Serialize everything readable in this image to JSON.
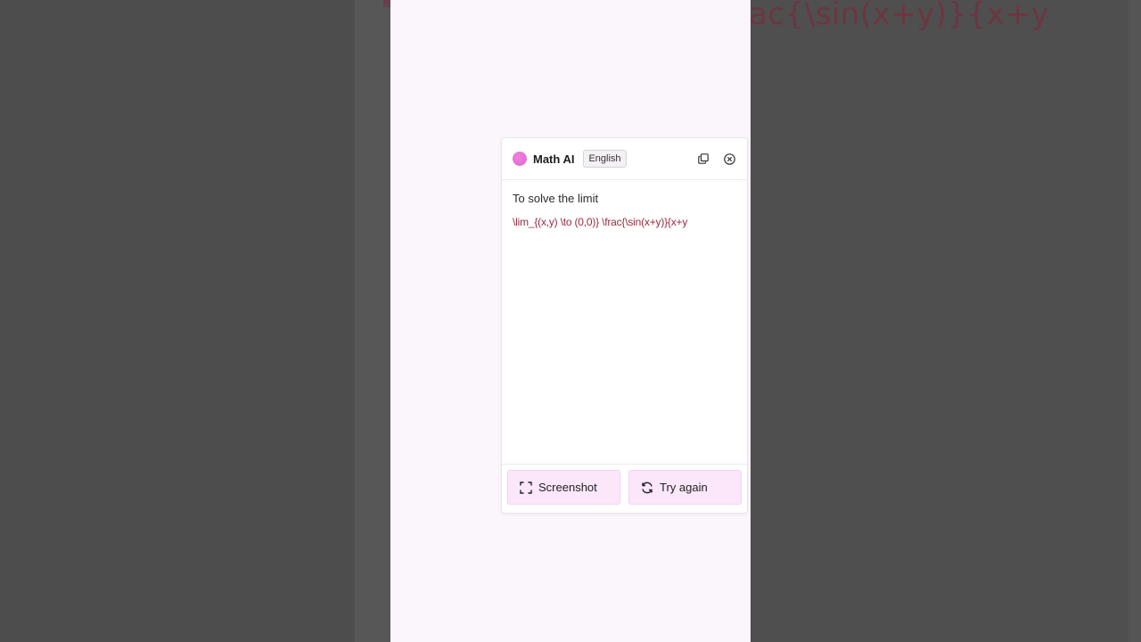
{
  "background": {
    "math_fragment": "ac{\\sin(x+y)}{x+y"
  },
  "panel": {
    "app_name": "Math AI",
    "language": "English",
    "icons": {
      "copy": "copy-icon",
      "close": "close-circle-icon",
      "screenshot": "crop-frame-icon",
      "retry": "refresh-icon"
    },
    "body": {
      "intro": "To solve the limit",
      "latex": "\\lim_{(x,y) \\to (0,0)} \\frac{\\sin(x+y)}{x+y"
    },
    "footer": {
      "screenshot_label": "Screenshot",
      "try_again_label": "Try again"
    }
  },
  "colors": {
    "accent_pink": "#fbe6fa",
    "logo_pink": "#e576d9",
    "latex_red": "#9b2a3f",
    "stage_bg": "#fbf6fc"
  }
}
